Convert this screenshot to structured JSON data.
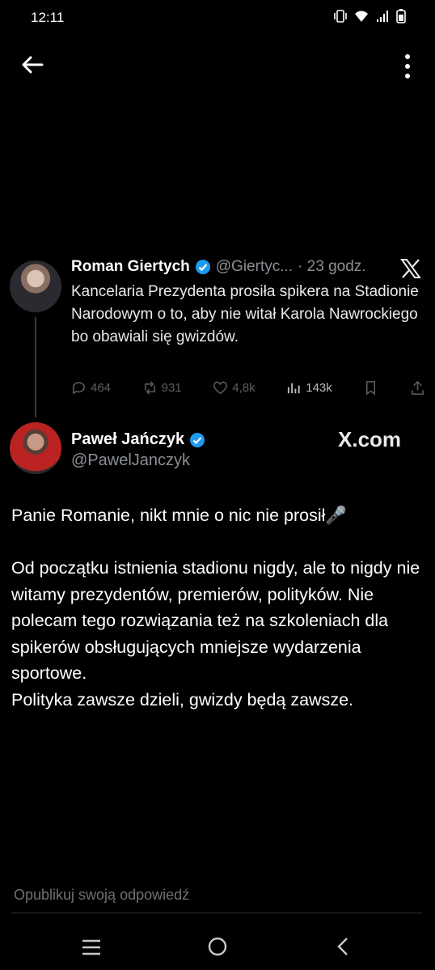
{
  "status_bar": {
    "time": "12:11"
  },
  "quoted_tweet": {
    "name": "Roman Giertych",
    "handle": "@Giertyc...",
    "time": "· 23 godz.",
    "text": "Kancelaria Prezydenta prosiła spikera na Stadionie Narodowym o to, aby nie witał Karola Nawrockiego bo obawiali się gwizdów.",
    "replies": "464",
    "retweets": "931",
    "likes": "4,8k",
    "views": "143k"
  },
  "tweet": {
    "name": "Paweł Jańczyk",
    "handle": "@PawelJanczyk",
    "watermark": "X.com",
    "text": "Panie Romanie, nikt mnie o nic nie prosił🎤\n\nOd początku istnienia stadionu nigdy, ale to nigdy nie witamy prezydentów, premierów, polityków. Nie polecam tego rozwiązania też na szkoleniach dla spikerów obsługujących mniejsze wydarzenia sportowe.\nPolityka zawsze dzieli, gwizdy będą zawsze."
  },
  "reply": {
    "placeholder": "Opublikuj swoją odpowiedź"
  },
  "colors": {
    "verified": "#1d9bf0",
    "background": "#000000",
    "muted": "#8b8f94"
  }
}
